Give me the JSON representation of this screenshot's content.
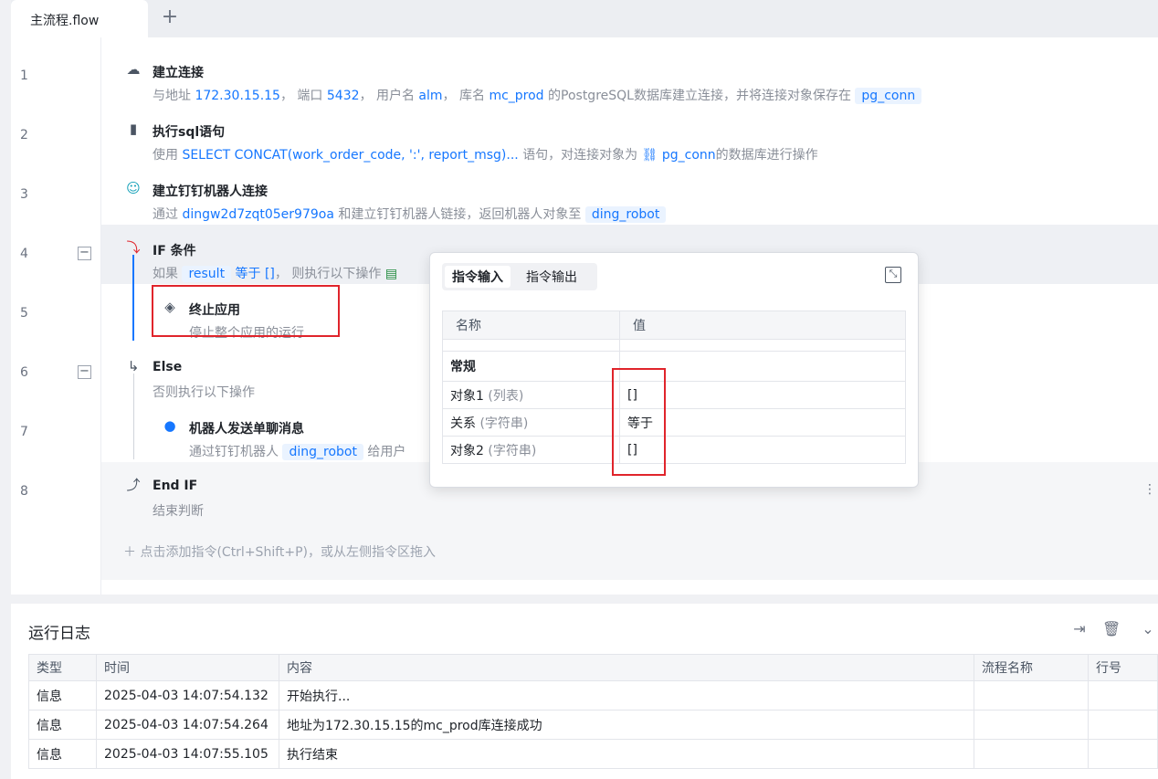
{
  "tab": {
    "label": "主流程.flow",
    "add": "+"
  },
  "lines": [
    "1",
    "2",
    "3",
    "4",
    "5",
    "6",
    "7",
    "8"
  ],
  "collapse_symbol": "−",
  "steps": {
    "s1": {
      "title": "建立连接",
      "d1": "与地址",
      "host": "172.30.15.15",
      "d2": "， 端口",
      "port": "5432",
      "d3": "， 用户名",
      "user": "alm",
      "d4": "， 库名",
      "db": "mc_prod",
      "d5": "的PostgreSQL数据库建立连接，并将连接对象保存在",
      "var": "pg_conn"
    },
    "s2": {
      "title": "执行sql语句",
      "d1": "使用",
      "sql": "SELECT    CONCAT(work_order_code, ':', report_msg)...",
      "d2": "语句，对连接对象为",
      "conn": "pg_conn",
      "d3": "的数据库进行操作"
    },
    "s3": {
      "title": "建立钉钉机器人连接",
      "d1": "通过",
      "key": "dingw2d7zqt05er979oa",
      "d2": "和建立钉钉机器人链接，返回机器人对象至",
      "var": "ding_robot"
    },
    "s4": {
      "title": "IF 条件",
      "d1": "如果",
      "v1": "result",
      "op": "等于",
      "v2": "[]",
      "d2": "， 则执行以下操作"
    },
    "s5": {
      "title": "终止应用",
      "desc": "停止整个应用的运行"
    },
    "s6": {
      "title": "Else",
      "desc": "否则执行以下操作"
    },
    "s7": {
      "title": "机器人发送单聊消息",
      "d1": "通过钉钉机器人",
      "var": "ding_robot",
      "d2": "给用户"
    },
    "s8": {
      "title": "End IF",
      "desc": "结束判断"
    }
  },
  "add_hint": "点击添加指令(Ctrl+Shift+P)，或从左侧指令区拖入",
  "popup": {
    "tab_in": "指令输入",
    "tab_out": "指令输出",
    "col_name": "名称",
    "col_value": "值",
    "group": "常规",
    "rows": [
      {
        "name": "对象1",
        "type": "(列表)",
        "value": "[]"
      },
      {
        "name": "关系",
        "type": "(字符串)",
        "value": "等于"
      },
      {
        "name": "对象2",
        "type": "(字符串)",
        "value": "[]"
      }
    ]
  },
  "log": {
    "title": "运行日志",
    "headers": [
      "类型",
      "时间",
      "内容",
      "流程名称",
      "行号"
    ],
    "rows": [
      [
        "信息",
        "2025-04-03 14:07:54.132",
        "开始执行...",
        "",
        ""
      ],
      [
        "信息",
        "2025-04-03 14:07:54.264",
        "地址为172.30.15.15的mc_prod库连接成功",
        "",
        ""
      ],
      [
        "信息",
        "2025-04-03 14:07:55.105",
        "执行结束",
        "",
        ""
      ]
    ]
  },
  "colors": {
    "accent": "#1677ff",
    "highlight_box": "#e0242b"
  }
}
